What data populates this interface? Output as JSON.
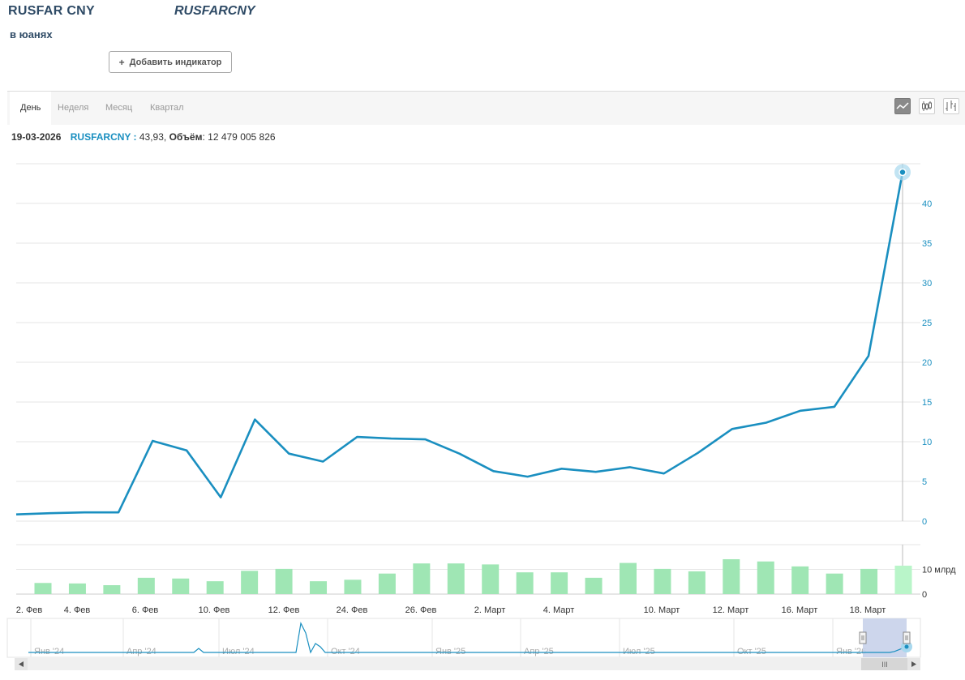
{
  "header": {
    "title": "RUSFAR CNY",
    "ticker": "RUSFARCNY",
    "subtitle": "в юанях",
    "add_indicator_label": "Добавить индикатор"
  },
  "tabs": [
    {
      "label": "День",
      "active": true
    },
    {
      "label": "Неделя",
      "active": false
    },
    {
      "label": "Месяц",
      "active": false
    },
    {
      "label": "Квартал",
      "active": false
    }
  ],
  "chart_types": [
    "line-chart-icon",
    "ohlc-chart-icon",
    "candlestick-chart-icon"
  ],
  "info": {
    "date": "19-03-2026",
    "symbol": "RUSFARCNY :",
    "value": "43,93,",
    "volume_label": "Объём",
    "volume_value": ": 12 479 005 826"
  },
  "colors": {
    "line": "#1a8fc0",
    "volume": "#9fe6b4",
    "volume_last": "#b9f5c9",
    "navigator_band": "#c8d2ea",
    "text_dark": "#2f4b66"
  },
  "chart_data": [
    {
      "type": "line",
      "series": [
        {
          "name": "RUSFARCNY",
          "values": [
            0.85,
            1.0,
            1.1,
            1.1,
            10.1,
            8.9,
            3.0,
            12.8,
            8.5,
            7.5,
            10.6,
            10.4,
            10.3,
            8.5,
            6.3,
            5.6,
            6.6,
            6.2,
            6.8,
            6.0,
            8.6,
            11.6,
            12.4,
            13.9,
            14.4,
            20.8,
            43.93
          ]
        }
      ],
      "x_tick_labels": [
        "2. Фев",
        "4. Фев",
        "6. Фев",
        "10. Фев",
        "12. Фев",
        "24. Фев",
        "26. Фев",
        "2. Март",
        "4. Март",
        "10. Март",
        "12. Март",
        "16. Март",
        "18. Март"
      ],
      "y_ticks": [
        0,
        5,
        10,
        15,
        20,
        25,
        30,
        35,
        40
      ],
      "ylim": [
        0,
        45
      ],
      "grid": true,
      "y_axis_side": "right"
    },
    {
      "type": "bar",
      "series": [
        {
          "name": "Объём",
          "values": [
            4.5,
            4.3,
            3.6,
            6.6,
            6.3,
            5.2,
            9.4,
            10.2,
            5.2,
            5.8,
            8.3,
            12.4,
            12.4,
            12.0,
            8.8,
            8.8,
            6.6,
            12.6,
            10.2,
            9.2,
            14.1,
            13.2,
            11.2,
            8.3,
            10.2,
            11.5
          ]
        }
      ],
      "y_ticks": [
        "0",
        "10 млрд"
      ],
      "ylim": [
        0,
        20
      ]
    }
  ],
  "navigator": {
    "labels": [
      "Янв '24",
      "Апр '24",
      "Июл '24",
      "Окт '24",
      "Янв '25",
      "Апр '25",
      "Июл '25",
      "Окт '25",
      "Янв '26"
    ],
    "scrollbar_grip": "III"
  }
}
